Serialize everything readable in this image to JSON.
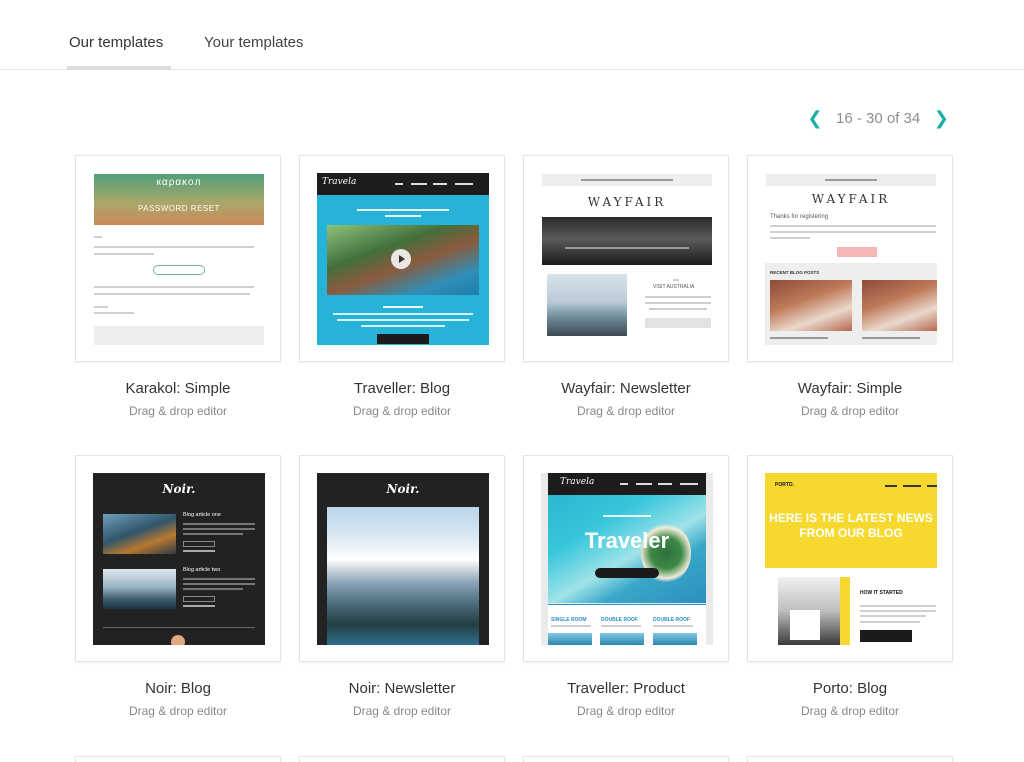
{
  "tabs": [
    {
      "label": "Our templates",
      "active": true
    },
    {
      "label": "Your templates",
      "active": false
    }
  ],
  "pagination": {
    "range_text": "16 - 30 of 34",
    "prev_icon": "chevron-left-icon",
    "next_icon": "chevron-right-icon",
    "accent_color": "#19b0a8"
  },
  "templates": [
    {
      "title": "Karakol: Simple",
      "subtitle": "Drag & drop editor",
      "preview": {
        "brand": "кαρακοл",
        "heading": "PASSWORD RESET"
      }
    },
    {
      "title": "Traveller: Blog",
      "subtitle": "Drag & drop editor",
      "preview": {
        "logo": "Travela"
      }
    },
    {
      "title": "Wayfair: Newsletter",
      "subtitle": "Drag & drop editor",
      "preview": {
        "logo": "WAYFAIR",
        "caption": "VISIT AUSTRALIA"
      }
    },
    {
      "title": "Wayfair: Simple",
      "subtitle": "Drag & drop editor",
      "preview": {
        "logo": "WAYFAIR",
        "greeting": "Thanks for registering",
        "section": "RECENT BLOG POSTS"
      }
    },
    {
      "title": "Noir: Blog",
      "subtitle": "Drag & drop editor",
      "preview": {
        "logo": "Noir.",
        "article1": "Blog article one",
        "article2": "Blog article two"
      }
    },
    {
      "title": "Noir: Newsletter",
      "subtitle": "Drag & drop editor",
      "preview": {
        "logo": "Noir."
      }
    },
    {
      "title": "Traveller: Product",
      "subtitle": "Drag & drop editor",
      "preview": {
        "logo": "Travela",
        "heading": "Traveler",
        "room1": "SINGLE ROOM",
        "room2": "DOUBLE ROOF",
        "room3": "DOUBLE ROOF"
      }
    },
    {
      "title": "Porto: Blog",
      "subtitle": "Drag & drop editor",
      "preview": {
        "logo": "PORTO.",
        "heading": "HERE IS THE LATEST NEWS FROM OUR BLOG",
        "subheading": "HOW IT STARTED"
      }
    }
  ]
}
